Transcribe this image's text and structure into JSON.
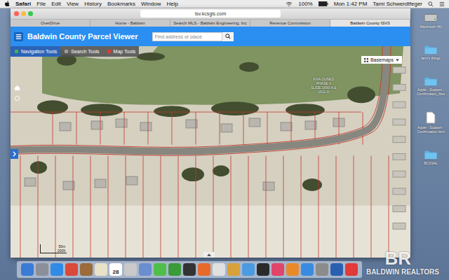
{
  "menubar": {
    "app": "Safari",
    "menus": [
      "File",
      "Edit",
      "View",
      "History",
      "Bookmarks",
      "Window",
      "Help"
    ],
    "battery": "100%",
    "clock": "Mon 1:42 PM",
    "user": "Tami Schwerdtfeger"
  },
  "browser": {
    "address": "isv.kcsgis.com",
    "tabs": [
      {
        "label": "OverDrive",
        "selected": false
      },
      {
        "label": "Home - Baldwin",
        "selected": false
      },
      {
        "label": "Search MLS - Baldwin Engineering, Inc",
        "selected": false
      },
      {
        "label": "Revenue Commission",
        "selected": false
      },
      {
        "label": "Baldwin County ISV3",
        "selected": true
      }
    ]
  },
  "app": {
    "title": "Baldwin County Parcel Viewer",
    "search_placeholder": "Find address or place",
    "tools": [
      {
        "label": "Navigation Tools",
        "selected": true
      },
      {
        "label": "Search Tools",
        "selected": false
      },
      {
        "label": "Map Tools",
        "selected": false
      }
    ],
    "basemaps": "Basemaps",
    "map_label": [
      "KIVA DUNES",
      "PHASE 3",
      "SLIDE 1693-A &",
      "1611-A"
    ],
    "scale": [
      "50m",
      "200ft"
    ]
  },
  "desktop_icons": [
    {
      "label": "Macintosh HD",
      "kind": "drive"
    },
    {
      "label": "tami's things",
      "kind": "folder"
    },
    {
      "label": "Apple - Support - Confirmation_files",
      "kind": "folder"
    },
    {
      "label": "Apple - Support - Confirmation.html",
      "kind": "file"
    },
    {
      "label": "BCSSAL",
      "kind": "folder"
    }
  ],
  "dock": {
    "calendar_day": "28",
    "apps": [
      {
        "color": "#3a7bd5"
      },
      {
        "color": "#8a8f99"
      },
      {
        "color": "#2f8be6"
      },
      {
        "color": "#d94a3a"
      },
      {
        "color": "#9b6b3a"
      },
      {
        "color": "#e8e2c8"
      },
      {
        "color": "#ffffff"
      },
      {
        "color": "#c9c9c9"
      },
      {
        "color": "#6a8fd0"
      },
      {
        "color": "#4fbf4a"
      },
      {
        "color": "#3a9b3a"
      },
      {
        "color": "#333333"
      },
      {
        "color": "#e86a2a"
      },
      {
        "color": "#e0e0e0"
      },
      {
        "color": "#d8a13a"
      },
      {
        "color": "#4a9be0"
      },
      {
        "color": "#2b2b2b"
      },
      {
        "color": "#e0456a"
      },
      {
        "color": "#e88a2a"
      },
      {
        "color": "#3a8be0"
      },
      {
        "color": "#8c8c8c"
      },
      {
        "color": "#2b5fb0"
      },
      {
        "color": "#e03a3a"
      }
    ]
  },
  "watermark": {
    "mark": "BR",
    "name": "BALDWIN REALTORS"
  }
}
